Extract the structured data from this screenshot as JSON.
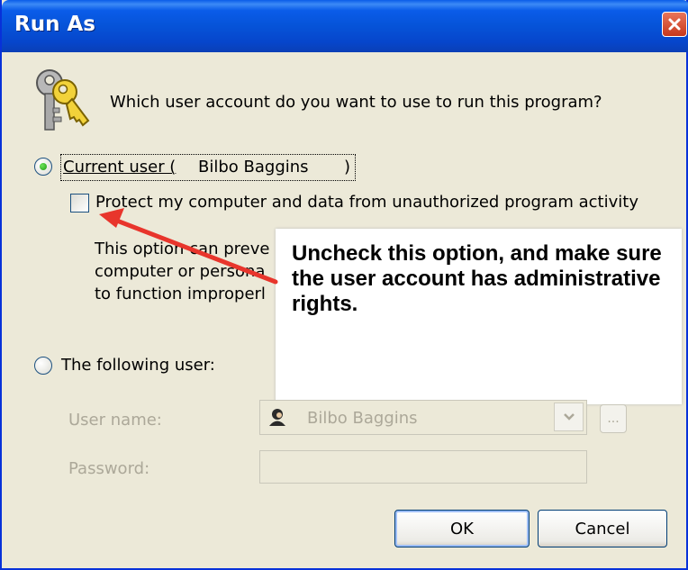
{
  "window": {
    "title": "Run As"
  },
  "prompt": "Which user account do you want to use to run this program?",
  "current_user": {
    "label_prefix": "Current user (",
    "name": "Bilbo Baggins",
    "label_suffix": ")",
    "selected": true
  },
  "protect": {
    "label": "Protect my computer and data from unauthorized program activity",
    "checked": false,
    "description_lines": [
      "This option can preve",
      "computer or persona",
      "to function improperl"
    ]
  },
  "callout": {
    "text": "Uncheck this option, and make sure the user account has administrative rights."
  },
  "following_user": {
    "label": "The following user:",
    "selected": false,
    "user_name_label": "User name:",
    "user_name_value": "Bilbo Baggins",
    "password_label": "Password:",
    "password_value": "",
    "browse_label": "..."
  },
  "buttons": {
    "ok": "OK",
    "cancel": "Cancel"
  },
  "colors": {
    "titlebar": "#0a5ce9",
    "close_button": "#d9492a",
    "arrow": "#e8352c",
    "radio_dot": "#2ea820"
  },
  "icons": {
    "program": "keys-icon",
    "user": "user-icon",
    "close": "close-icon",
    "dropdown": "chevron-down-icon"
  }
}
